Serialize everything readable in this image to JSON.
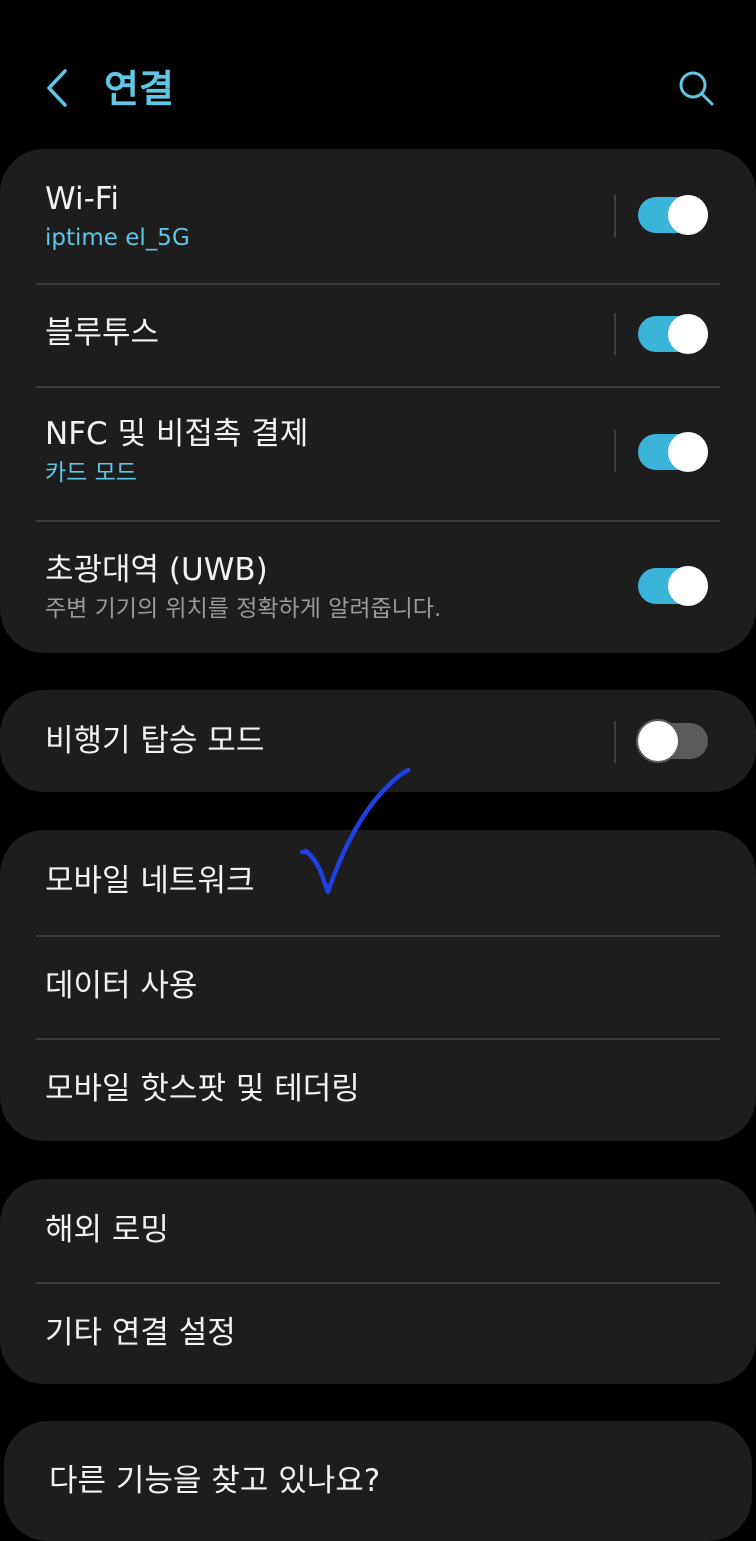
{
  "header": {
    "title": "연결",
    "back_icon": "back-arrow-icon",
    "search_icon": "search-icon",
    "accent_color": "#5fc6e6"
  },
  "connections": {
    "wifi": {
      "title": "Wi-Fi",
      "subtitle": "iptime el_5G",
      "enabled": true
    },
    "bluetooth": {
      "title": "블루투스",
      "enabled": true
    },
    "nfc": {
      "title": "NFC 및 비접촉 결제",
      "subtitle": "카드 모드",
      "enabled": true
    },
    "uwb": {
      "title": "초광대역 (UWB)",
      "subtitle": "주변 기기의 위치를 정확하게 알려줍니다.",
      "enabled": true
    }
  },
  "airplane": {
    "title": "비행기 탑승 모드",
    "enabled": false
  },
  "mobile": {
    "items": [
      {
        "title": "모바일 네트워크"
      },
      {
        "title": "데이터 사용"
      },
      {
        "title": "모바일 핫스팟 및 테더링"
      }
    ]
  },
  "more": {
    "items": [
      {
        "title": "해외 로밍"
      },
      {
        "title": "기타 연결 설정"
      }
    ]
  },
  "suggestion": {
    "title": "다른 기능을 찾고 있나요?"
  },
  "colors": {
    "toggle_on": "#3bb4da",
    "toggle_off": "#5b5b5b",
    "card_bg": "#1d1d1d",
    "annotation": "#1f3fe0"
  }
}
